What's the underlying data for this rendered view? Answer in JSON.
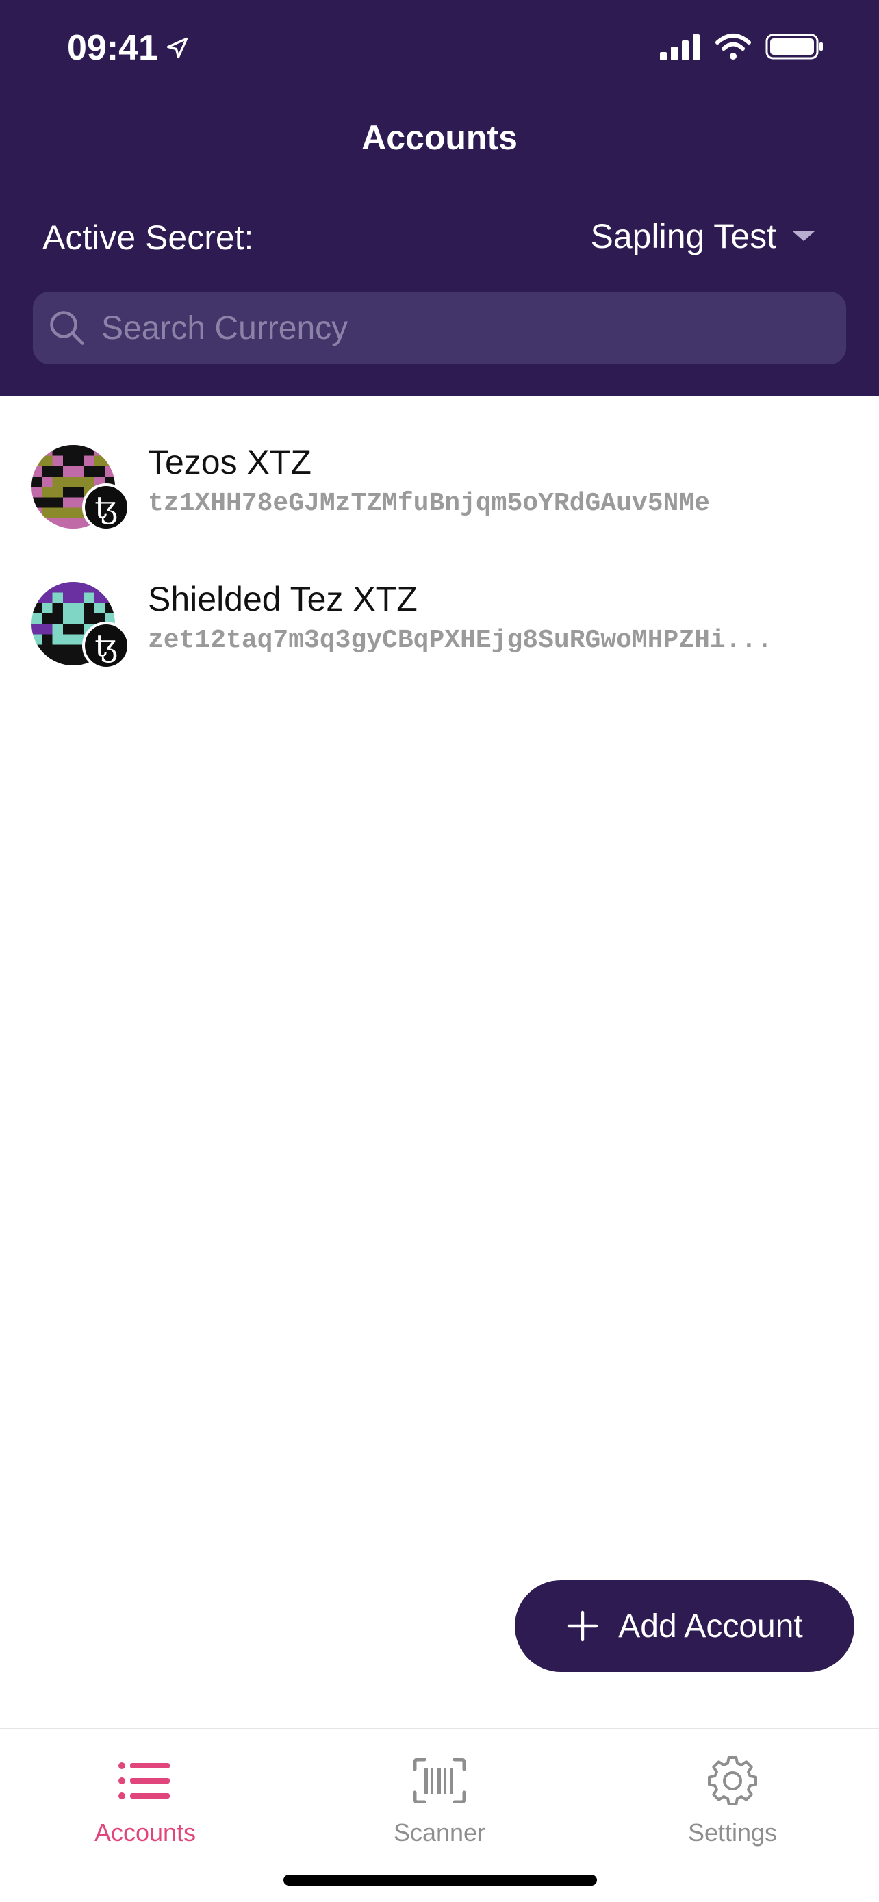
{
  "status_bar": {
    "time": "09:41"
  },
  "header": {
    "title": "Accounts",
    "active_secret_label": "Active Secret:",
    "active_secret_value": "Sapling Test",
    "search_placeholder": "Search Currency"
  },
  "accounts": [
    {
      "name": "Tezos",
      "symbol": "XTZ",
      "address": "tz1XHH78eGJMzTZMfuBnjqm5oYRdGAuv5NMe",
      "badge": "ꜩ"
    },
    {
      "name": "Shielded Tez",
      "symbol": "XTZ",
      "address": "zet12taq7m3q3gyCBqPXHEjg8SuRGwoMHPZHi...",
      "badge": "ꜩ"
    }
  ],
  "add_account_label": "Add Account",
  "tabs": [
    {
      "label": "Accounts",
      "active": true,
      "icon": "list-icon"
    },
    {
      "label": "Scanner",
      "active": false,
      "icon": "barcode-icon"
    },
    {
      "label": "Settings",
      "active": false,
      "icon": "gear-icon"
    }
  ],
  "colors": {
    "header_bg": "#2d1b52",
    "accent": "#e0457b",
    "inactive": "#8e8e8e"
  }
}
